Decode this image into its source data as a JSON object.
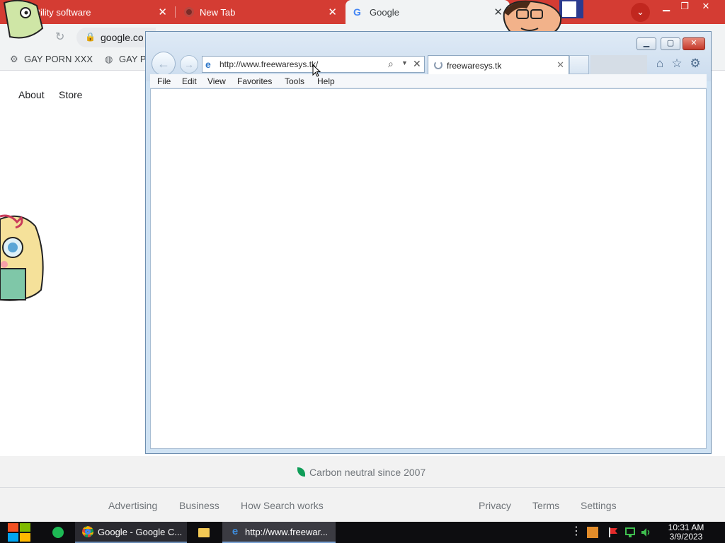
{
  "chrome": {
    "tabs": [
      {
        "label": "Utility software",
        "close": "✕"
      },
      {
        "label": "New Tab",
        "close": "✕"
      },
      {
        "label": "Google",
        "close": "✕"
      }
    ],
    "url": "google.co",
    "bookmarks": [
      "GAY PORN XXX",
      "GAY P"
    ],
    "menu_glyph": "⌄"
  },
  "google": {
    "nav": [
      "About",
      "Store"
    ],
    "carbon": "Carbon neutral since 2007",
    "footer_left": [
      "Advertising",
      "Business",
      "How Search works"
    ],
    "footer_right": [
      "Privacy",
      "Terms",
      "Settings"
    ]
  },
  "ie": {
    "address_url": "http://www.freewaresys.tk/",
    "tab_title": "freewaresys.tk",
    "menu": [
      "File",
      "Edit",
      "View",
      "Favorites",
      "Tools",
      "Help"
    ],
    "icons": {
      "home": "home-icon",
      "favorites": "star-icon",
      "tools": "gear-icon"
    }
  },
  "taskbar": {
    "chrome_label": "Google - Google C...",
    "ie_label": "http://www.freewar...",
    "time": "10:31 AM",
    "date": "3/9/2023"
  },
  "colors": {
    "chrome_tabstrip": "#d43c33",
    "ie_frame": "#cfe2f3",
    "taskbar": "#0d0d10"
  }
}
